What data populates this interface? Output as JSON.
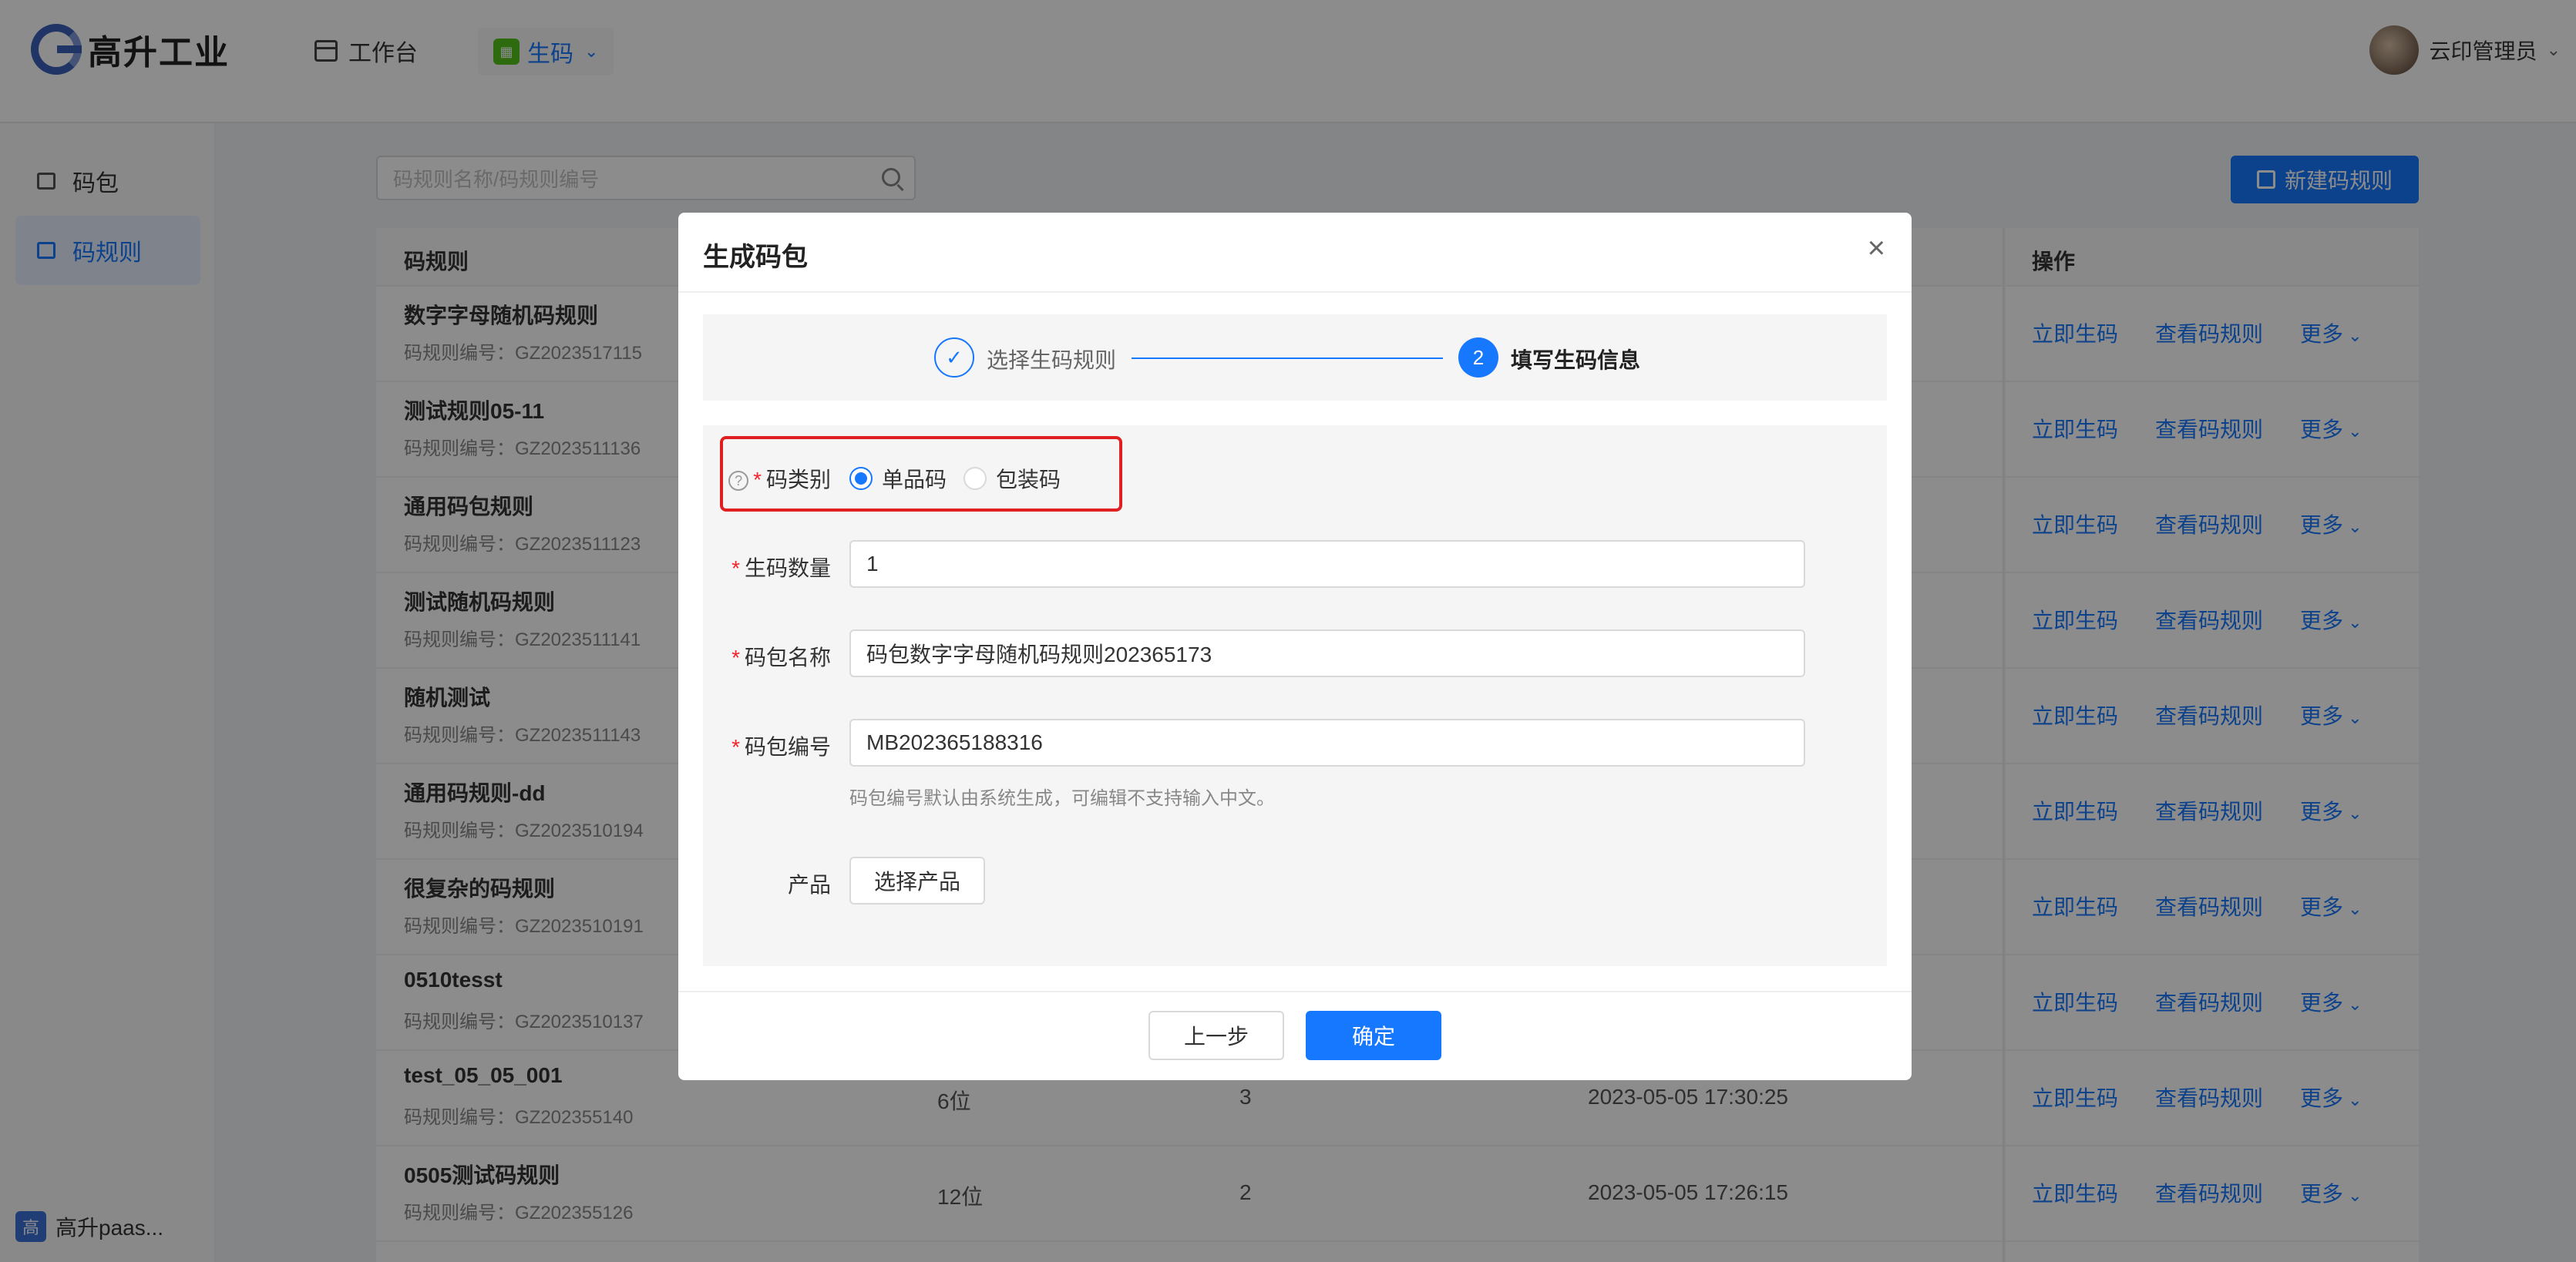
{
  "header": {
    "logo_text": "高升工业",
    "workbench_label": "工作台",
    "app_label": "生码",
    "user_name": "云印管理员"
  },
  "sidebar": {
    "items": [
      {
        "label": "码包"
      },
      {
        "label": "码规则"
      }
    ],
    "bottom_label": "高升paas..."
  },
  "main": {
    "search_placeholder": "码规则名称/码规则编号",
    "new_button": "新建码规则",
    "columns": {
      "rule": "码规则",
      "ops": "操作"
    },
    "rows": [
      {
        "name": "数字字母随机码规则",
        "code": "码规则编号：GZ2023517115",
        "c2": "",
        "c3": "",
        "c4": ""
      },
      {
        "name": "测试规则05-11",
        "code": "码规则编号：GZ2023511136",
        "c2": "",
        "c3": "",
        "c4": ""
      },
      {
        "name": "通用码包规则",
        "code": "码规则编号：GZ2023511123",
        "c2": "",
        "c3": "",
        "c4": ""
      },
      {
        "name": "测试随机码规则",
        "code": "码规则编号：GZ2023511141",
        "c2": "",
        "c3": "",
        "c4": ""
      },
      {
        "name": "随机测试",
        "code": "码规则编号：GZ2023511143",
        "c2": "",
        "c3": "",
        "c4": ""
      },
      {
        "name": "通用码规则-dd",
        "code": "码规则编号：GZ2023510194",
        "c2": "",
        "c3": "",
        "c4": ""
      },
      {
        "name": "很复杂的码规则",
        "code": "码规则编号：GZ2023510191",
        "c2": "",
        "c3": "",
        "c4": ""
      },
      {
        "name": "0510tesst",
        "code": "码规则编号：GZ2023510137",
        "c2": "",
        "c3": "",
        "c4": ""
      },
      {
        "name": "test_05_05_001",
        "code": "码规则编号：GZ202355140",
        "c2": "6位",
        "c3": "3",
        "c4": "2023-05-05 17:30:25"
      },
      {
        "name": "0505测试码规则",
        "code": "码规则编号：GZ202355126",
        "c2": "12位",
        "c3": "2",
        "c4": "2023-05-05 17:26:15"
      }
    ],
    "ops": {
      "generate": "立即生码",
      "view": "查看码规则",
      "more": "更多"
    }
  },
  "modal": {
    "title": "生成码包",
    "close_icon": "×",
    "steps": [
      {
        "number": "✓",
        "label": "选择生码规则",
        "status": "done"
      },
      {
        "number": "2",
        "label": "填写生码信息",
        "status": "current"
      }
    ],
    "form": {
      "code_type_label": "码类别",
      "code_type_options": [
        "单品码",
        "包装码"
      ],
      "code_type_selected": "单品码",
      "quantity_label": "生码数量",
      "quantity_value": "1",
      "pack_name_label": "码包名称",
      "pack_name_value": "码包数字字母随机码规则202365173",
      "pack_no_label": "码包编号",
      "pack_no_value": "MB202365188316",
      "pack_no_hint": "码包编号默认由系统生成，可编辑不支持输入中文。",
      "product_label": "产品",
      "product_button": "选择产品"
    },
    "footer": {
      "prev": "上一步",
      "ok": "确定"
    }
  },
  "colors": {
    "primary": "#1677ff",
    "highlight": "#e02020",
    "required": "#f5222d"
  }
}
